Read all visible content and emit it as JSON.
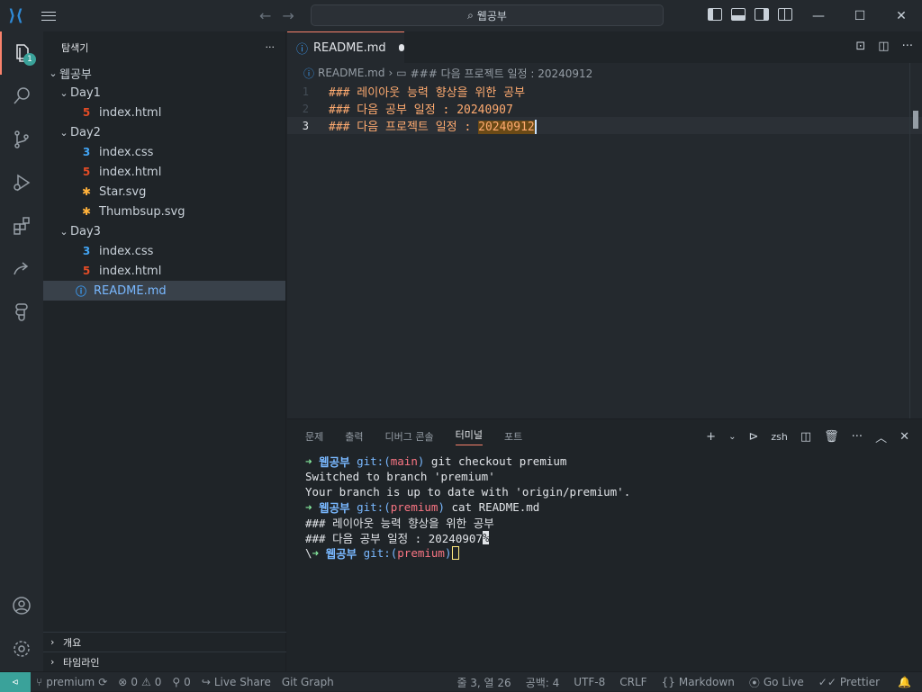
{
  "titlebar": {
    "search_text": "웹공부",
    "icons": [
      "vscode-logo-icon",
      "menu-icon",
      "arrow-left-icon",
      "arrow-right-icon",
      "search-icon",
      "toggle-primary-sidebar-icon",
      "toggle-panel-icon",
      "toggle-secondary-sidebar-icon",
      "customize-layout-icon",
      "minimize-icon",
      "maximize-icon",
      "close-icon"
    ]
  },
  "activity": {
    "explorer_badge": "1"
  },
  "sidebar": {
    "title": "탐색기",
    "more": "···",
    "root": "웹공부",
    "tree": [
      {
        "label": "Day1",
        "type": "folder",
        "depth": 1
      },
      {
        "label": "index.html",
        "type": "html",
        "depth": 2
      },
      {
        "label": "Day2",
        "type": "folder",
        "depth": 1
      },
      {
        "label": "index.css",
        "type": "css",
        "depth": 2
      },
      {
        "label": "index.html",
        "type": "html",
        "depth": 2
      },
      {
        "label": "Star.svg",
        "type": "svg",
        "depth": 2
      },
      {
        "label": "Thumbsup.svg",
        "type": "svg",
        "depth": 2
      },
      {
        "label": "Day3",
        "type": "folder",
        "depth": 1
      },
      {
        "label": "index.css",
        "type": "css",
        "depth": 2
      },
      {
        "label": "index.html",
        "type": "html",
        "depth": 2
      },
      {
        "label": "README.md",
        "type": "info",
        "depth": 1,
        "selected": true
      }
    ],
    "outline": "개요",
    "timeline": "타임라인"
  },
  "editor": {
    "tab_label": "README.md",
    "breadcrumb_file": "README.md",
    "breadcrumb_symbol": "### 다음 프로젝트 일정 : 20240912",
    "lines": [
      {
        "num": "1",
        "text": "### 레이아웃 능력 향상을 위한 공부"
      },
      {
        "num": "2",
        "text": "### 다음 공부 일정 : 20240907"
      },
      {
        "num": "3",
        "prefix": "### 다음 프로젝트 일정 : ",
        "highlight": "20240912"
      }
    ]
  },
  "panel": {
    "tabs": [
      "문제",
      "출력",
      "디버그 콘솔",
      "터미널",
      "포트"
    ],
    "active_tab": "터미널",
    "shell": "zsh",
    "terminal": {
      "l1": {
        "arrow": "➜",
        "dir": "웹공부",
        "git": "git:(",
        "branch": "main",
        "close": ")",
        "cmd": "git checkout premium"
      },
      "l2": "Switched to branch 'premium'",
      "l3": "Your branch is up to date with 'origin/premium'.",
      "l4": {
        "arrow": "➜",
        "dir": "웹공부",
        "git": "git:(",
        "branch": "premium",
        "close": ")",
        "cmd": "cat README.md"
      },
      "l5": "### 레이아웃 능력 향상을 위한 공부",
      "l6": "### 다음 공부 일정 : 20240907",
      "l6_cursor": "%",
      "l7": {
        "prefix": "\\",
        "arrow": "➜",
        "dir": "웹공부",
        "git": "git:(",
        "branch": "premium",
        "close": ")"
      }
    }
  },
  "statusbar": {
    "branch": "premium",
    "errors": "0",
    "warnings": "0",
    "ports": "0",
    "live_share": "Live Share",
    "git_graph": "Git Graph",
    "position": "줄 3, 열 26",
    "spaces": "공백: 4",
    "encoding": "UTF-8",
    "eol": "CRLF",
    "language": "Markdown",
    "go_live": "Go Live",
    "prettier": "Prettier"
  }
}
